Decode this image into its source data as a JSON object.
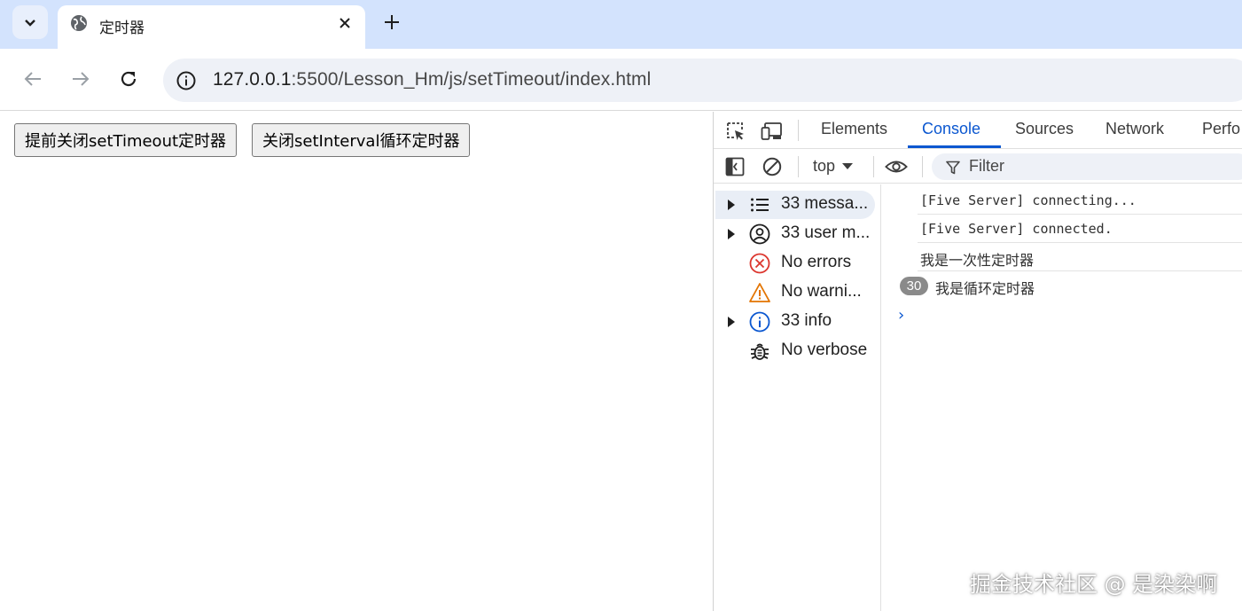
{
  "browser": {
    "tab": {
      "title": "定时器"
    },
    "url_host": "127.0.0.1",
    "url_path": ":5500/Lesson_Hm/js/setTimeout/index.html"
  },
  "page": {
    "buttons": [
      {
        "label": "提前关闭setTimeout定时器"
      },
      {
        "label": "关闭setInterval循环定时器"
      }
    ]
  },
  "devtools": {
    "tabs": [
      "Elements",
      "Console",
      "Sources",
      "Network",
      "Perfo"
    ],
    "active_tab": "Console",
    "context": "top",
    "filter_placeholder": "Filter",
    "sidebar": [
      {
        "label": "33 messa...",
        "icon": "list-icon",
        "expandable": true,
        "selected": true
      },
      {
        "label": "33 user m...",
        "icon": "user-icon",
        "expandable": true,
        "selected": false
      },
      {
        "label": "No errors",
        "icon": "error-icon",
        "expandable": false,
        "selected": false
      },
      {
        "label": "No warni...",
        "icon": "warning-icon",
        "expandable": false,
        "selected": false
      },
      {
        "label": "33 info",
        "icon": "info-icon",
        "expandable": true,
        "selected": false
      },
      {
        "label": "No verbose",
        "icon": "bug-icon",
        "expandable": false,
        "selected": false
      }
    ],
    "log": [
      {
        "text": "[Five Server] connecting...",
        "repeat": ""
      },
      {
        "text": "[Five Server] connected.",
        "repeat": ""
      },
      {
        "text": "我是一次性定时器",
        "repeat": ""
      },
      {
        "text": "我是循环定时器",
        "repeat": "30"
      }
    ],
    "prompt": "›"
  },
  "watermark": "掘金技术社区 @ 是染染啊",
  "colors": {
    "accent": "#0b57d0",
    "tab_strip": "#d3e3fd",
    "error": "#dc362e",
    "warning": "#e37400"
  }
}
